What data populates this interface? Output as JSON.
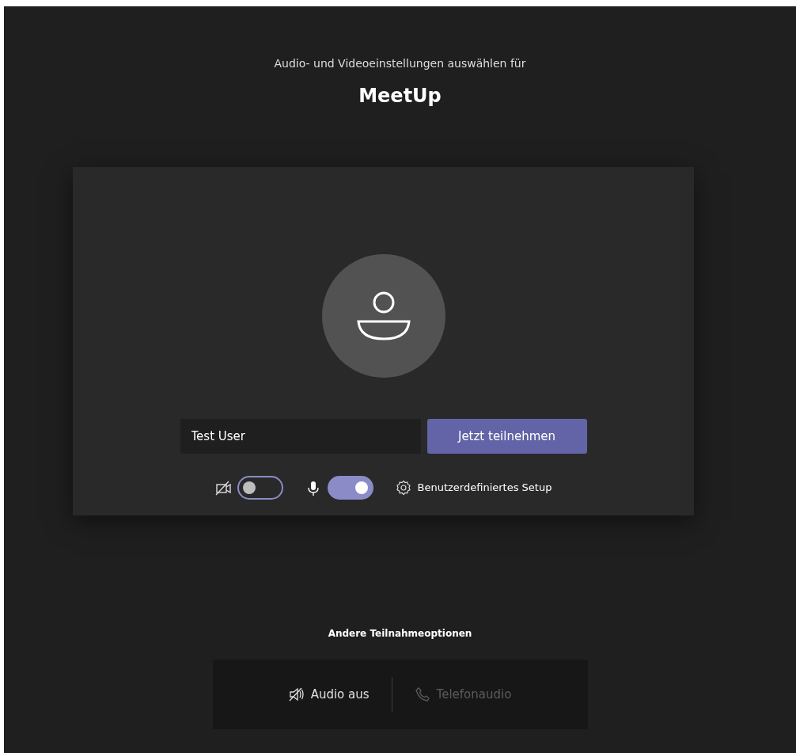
{
  "heading": "Audio- und Videoeinstellungen auswählen für",
  "meeting_title": "MeetUp",
  "name_field": {
    "value": "Test User"
  },
  "join_button": "Jetzt teilnehmen",
  "controls": [
    {
      "kind": "video",
      "on": false
    },
    {
      "kind": "mic",
      "on": true
    }
  ],
  "device_settings": "Benutzerdefiniertes Setup",
  "other_options": {
    "title": "Andere Teilnahmeoptionen",
    "options": [
      {
        "kind": "audio-off",
        "label": "Audio aus",
        "disabled": false
      },
      {
        "kind": "phone",
        "label": "Telefonaudio",
        "disabled": true
      }
    ]
  }
}
